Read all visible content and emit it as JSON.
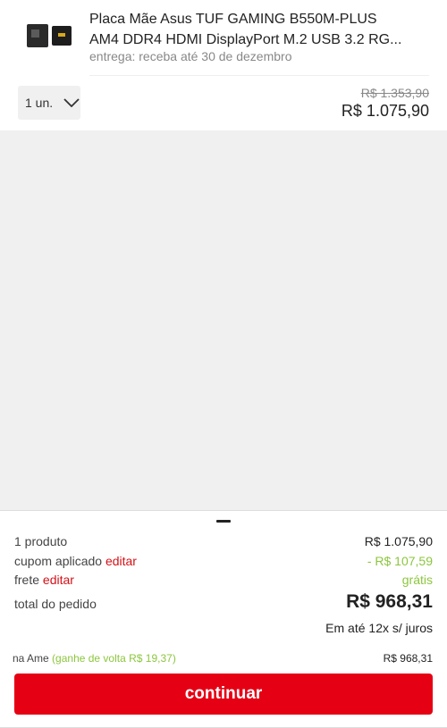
{
  "product": {
    "title_line1": "Placa Mãe Asus TUF GAMING B550M-PLUS",
    "title_line2": "AM4 DDR4 HDMI DisplayPort M.2 USB 3.2 RG...",
    "delivery": "entrega: receba até 30 de dezembro",
    "quantity": "1 un.",
    "old_price": "R$ 1.353,90",
    "price": "R$ 1.075,90",
    "thumbnail_icon": "motherboard-thumbnail"
  },
  "summary": {
    "products_label": "1 produto",
    "products_value": "R$ 1.075,90",
    "coupon_label": "cupom aplicado",
    "coupon_edit": "editar",
    "coupon_value": "- R$ 107,59",
    "shipping_label": "frete",
    "shipping_edit": "editar",
    "shipping_value": "grátis",
    "total_label": "total do pedido",
    "total_value": "R$ 968,31",
    "installments": "Em até 12x s/ juros",
    "ame_label": "na Ame",
    "ame_cashback": "(ganhe de volta R$ 19,37)",
    "ame_value": "R$ 968,31",
    "continue_label": "continuar"
  },
  "colors": {
    "accent_red": "#e60014",
    "link_red": "#d31118",
    "discount_green": "#8cc63e",
    "background_gray": "#f0f0f0"
  }
}
